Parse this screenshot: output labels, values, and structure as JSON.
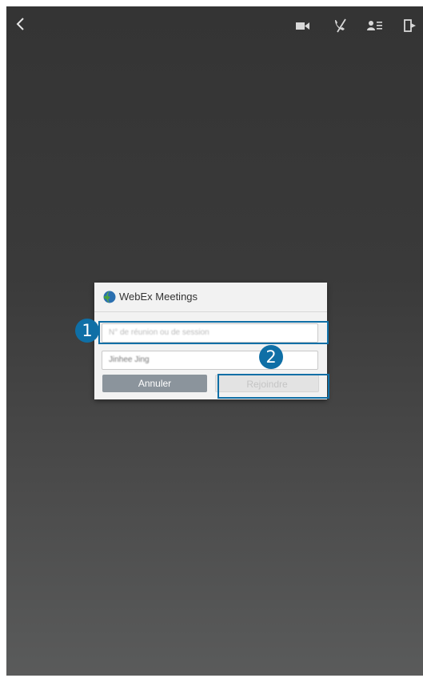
{
  "toolbar": {
    "back_icon": "chevron-left-icon",
    "icons": [
      "video-camera-icon",
      "mute-call-icon",
      "participants-list-icon",
      "exit-icon"
    ]
  },
  "dialog": {
    "title": "WebEx Meetings",
    "meeting_input": {
      "placeholder": "N° de réunion ou de session",
      "value": ""
    },
    "name_input": {
      "value": "Jinhee Jing"
    },
    "cancel_label": "Annuler",
    "join_label": "Rejoindre"
  },
  "callouts": {
    "one": "1",
    "two": "2"
  },
  "colors": {
    "callout": "#0f6fa6",
    "cancel_button": "#8b949c",
    "background_top": "#343434",
    "background_bottom": "#5a5b5b"
  }
}
